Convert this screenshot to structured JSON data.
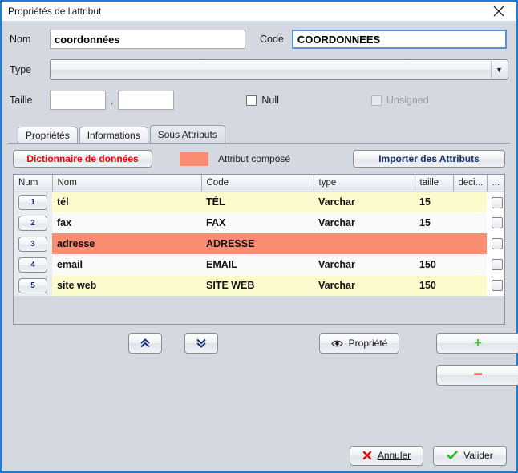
{
  "window": {
    "title": "Propriétés de l'attribut",
    "close_icon": "close-icon"
  },
  "form": {
    "nom_label": "Nom",
    "nom_value": "coordonnées",
    "code_label": "Code",
    "code_value": "COORDONNEES",
    "type_label": "Type",
    "type_value": "",
    "type_arrow_icon": "chevron-down-icon",
    "taille_label": "Taille",
    "taille_value": "",
    "decimales_value": "",
    "separator": ",",
    "null_label": "Null",
    "null_checked": false,
    "unsigned_label": "Unsigned",
    "unsigned_checked": false,
    "unsigned_disabled": true
  },
  "tabs": [
    {
      "label": "Propriétés",
      "active": false
    },
    {
      "label": "Informations",
      "active": false
    },
    {
      "label": "Sous Attributs",
      "active": true
    }
  ],
  "toolbar": {
    "dictionary_label": "Dictionnaire de données",
    "dictionary_color": "#ee0000",
    "composed_swatch_color": "#fa8c72",
    "composed_label": "Attribut composé",
    "import_label": "Importer des Attributs",
    "import_color": "#17306e"
  },
  "table": {
    "columns": [
      "Num",
      "Nom",
      "Code",
      "type",
      "taille",
      "deci...",
      "..."
    ],
    "rows": [
      {
        "num": "1",
        "nom": "tél",
        "code": "TÉL",
        "type": "Varchar",
        "taille": "15",
        "deci": "",
        "style": "row-y",
        "checked": false
      },
      {
        "num": "2",
        "nom": "fax",
        "code": "FAX",
        "type": "Varchar",
        "taille": "15",
        "deci": "",
        "style": "row-w",
        "checked": false
      },
      {
        "num": "3",
        "nom": "adresse",
        "code": "ADRESSE",
        "type": "",
        "taille": "",
        "deci": "",
        "style": "row-s",
        "checked": false
      },
      {
        "num": "4",
        "nom": "email",
        "code": "EMAIL",
        "type": "Varchar",
        "taille": "150",
        "deci": "",
        "style": "row-w",
        "checked": false
      },
      {
        "num": "5",
        "nom": "site web",
        "code": "SITE WEB",
        "type": "Varchar",
        "taille": "150",
        "deci": "",
        "style": "row-y",
        "checked": false
      }
    ]
  },
  "actions": {
    "move_up_icon": "double-chevron-up-icon",
    "move_down_icon": "double-chevron-down-icon",
    "property_label": "Propriété",
    "property_icon": "eye-icon",
    "add_label": "+",
    "add_color": "#3fc33f",
    "remove_label": "−",
    "remove_color": "#ee2222"
  },
  "footer": {
    "cancel_label": "Annuler",
    "cancel_icon": "red-x-icon",
    "validate_label": "Valider",
    "validate_icon": "green-check-icon"
  }
}
